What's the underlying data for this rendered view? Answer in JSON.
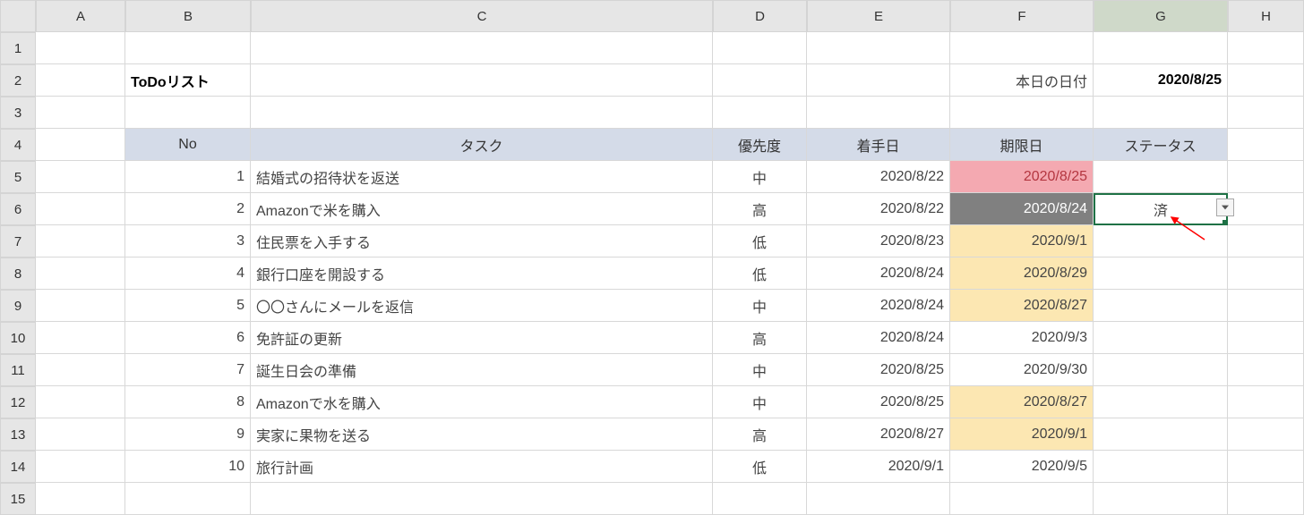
{
  "columns": [
    "A",
    "B",
    "C",
    "D",
    "E",
    "F",
    "G",
    "H"
  ],
  "rowCount": 15,
  "title": "ToDoリスト",
  "today_label": "本日の日付",
  "today_value": "2020/8/25",
  "headers": {
    "no": "No",
    "task": "タスク",
    "priority": "優先度",
    "start": "着手日",
    "due": "期限日",
    "status": "ステータス"
  },
  "selected_status": "済",
  "rows": [
    {
      "no": "1",
      "task": "結婚式の招待状を返送",
      "pri": "中",
      "start": "2020/8/22",
      "due": "2020/8/25",
      "due_hl": "red",
      "status": ""
    },
    {
      "no": "2",
      "task": "Amazonで米を購入",
      "pri": "高",
      "start": "2020/8/22",
      "due": "2020/8/24",
      "due_hl": "gray",
      "status": "済"
    },
    {
      "no": "3",
      "task": "住民票を入手する",
      "pri": "低",
      "start": "2020/8/23",
      "due": "2020/9/1",
      "due_hl": "yellow",
      "status": ""
    },
    {
      "no": "4",
      "task": "銀行口座を開設する",
      "pri": "低",
      "start": "2020/8/24",
      "due": "2020/8/29",
      "due_hl": "yellow",
      "status": ""
    },
    {
      "no": "5",
      "task": "〇〇さんにメールを返信",
      "pri": "中",
      "start": "2020/8/24",
      "due": "2020/8/27",
      "due_hl": "yellow",
      "status": ""
    },
    {
      "no": "6",
      "task": "免許証の更新",
      "pri": "高",
      "start": "2020/8/24",
      "due": "2020/9/3",
      "due_hl": "",
      "status": ""
    },
    {
      "no": "7",
      "task": "誕生日会の準備",
      "pri": "中",
      "start": "2020/8/25",
      "due": "2020/9/30",
      "due_hl": "",
      "status": ""
    },
    {
      "no": "8",
      "task": "Amazonで水を購入",
      "pri": "中",
      "start": "2020/8/25",
      "due": "2020/8/27",
      "due_hl": "yellow",
      "status": ""
    },
    {
      "no": "9",
      "task": "実家に果物を送る",
      "pri": "高",
      "start": "2020/8/27",
      "due": "2020/9/1",
      "due_hl": "yellow",
      "status": ""
    },
    {
      "no": "10",
      "task": "旅行計画",
      "pri": "低",
      "start": "2020/9/1",
      "due": "2020/9/5",
      "due_hl": "",
      "status": ""
    }
  ]
}
